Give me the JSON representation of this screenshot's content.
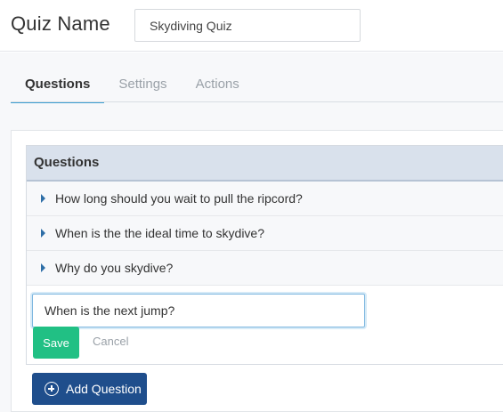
{
  "header": {
    "title": "Quiz Name",
    "quiz_name_value": "Skydiving Quiz"
  },
  "tabs": [
    {
      "label": "Questions",
      "active": true
    },
    {
      "label": "Settings",
      "active": false
    },
    {
      "label": "Actions",
      "active": false
    }
  ],
  "questions": {
    "heading": "Questions",
    "items": [
      {
        "text": "How long should you wait to pull the ripcord?"
      },
      {
        "text": "When is the the ideal time to skydive?"
      },
      {
        "text": "Why do you skydive?"
      }
    ]
  },
  "new_question": {
    "value": "When is the next jump?",
    "save_label": "Save",
    "cancel_label": "Cancel"
  },
  "add_question_label": "Add Question",
  "colors": {
    "accent": "#3c9fd1",
    "save": "#21c084",
    "primary": "#1f4e8c",
    "header_bg": "#d9e1ec"
  }
}
